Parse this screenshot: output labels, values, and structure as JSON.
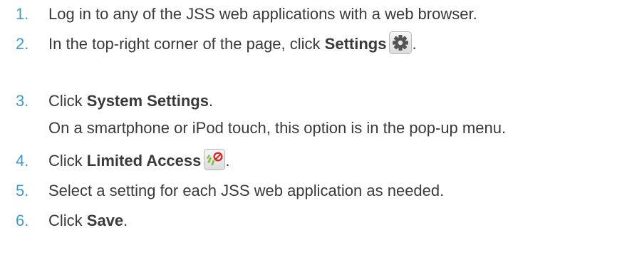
{
  "steps": [
    {
      "number": "1.",
      "text": "Log in to any of the JSS web applications with a web browser."
    },
    {
      "number": "2.",
      "before": "In the top-right corner of the page, click ",
      "bold": "Settings",
      "after": ".",
      "icon": "gear-icon"
    },
    {
      "number": "3.",
      "before": "Click ",
      "bold": "System Settings",
      "after": ".",
      "note": "On a smartphone or iPod touch, this option is in the pop-up menu."
    },
    {
      "number": "4.",
      "before": "Click ",
      "bold": "Limited Access",
      "after": ".",
      "icon": "limited-access-icon"
    },
    {
      "number": "5.",
      "text": "Select a setting for each JSS web application as needed."
    },
    {
      "number": "6.",
      "before": "Click ",
      "bold": "Save",
      "after": "."
    }
  ],
  "colors": {
    "number": "#3d9bd4",
    "text": "#3a3a3a",
    "icon_green": "#7cc242",
    "icon_red": "#d92b2b"
  }
}
